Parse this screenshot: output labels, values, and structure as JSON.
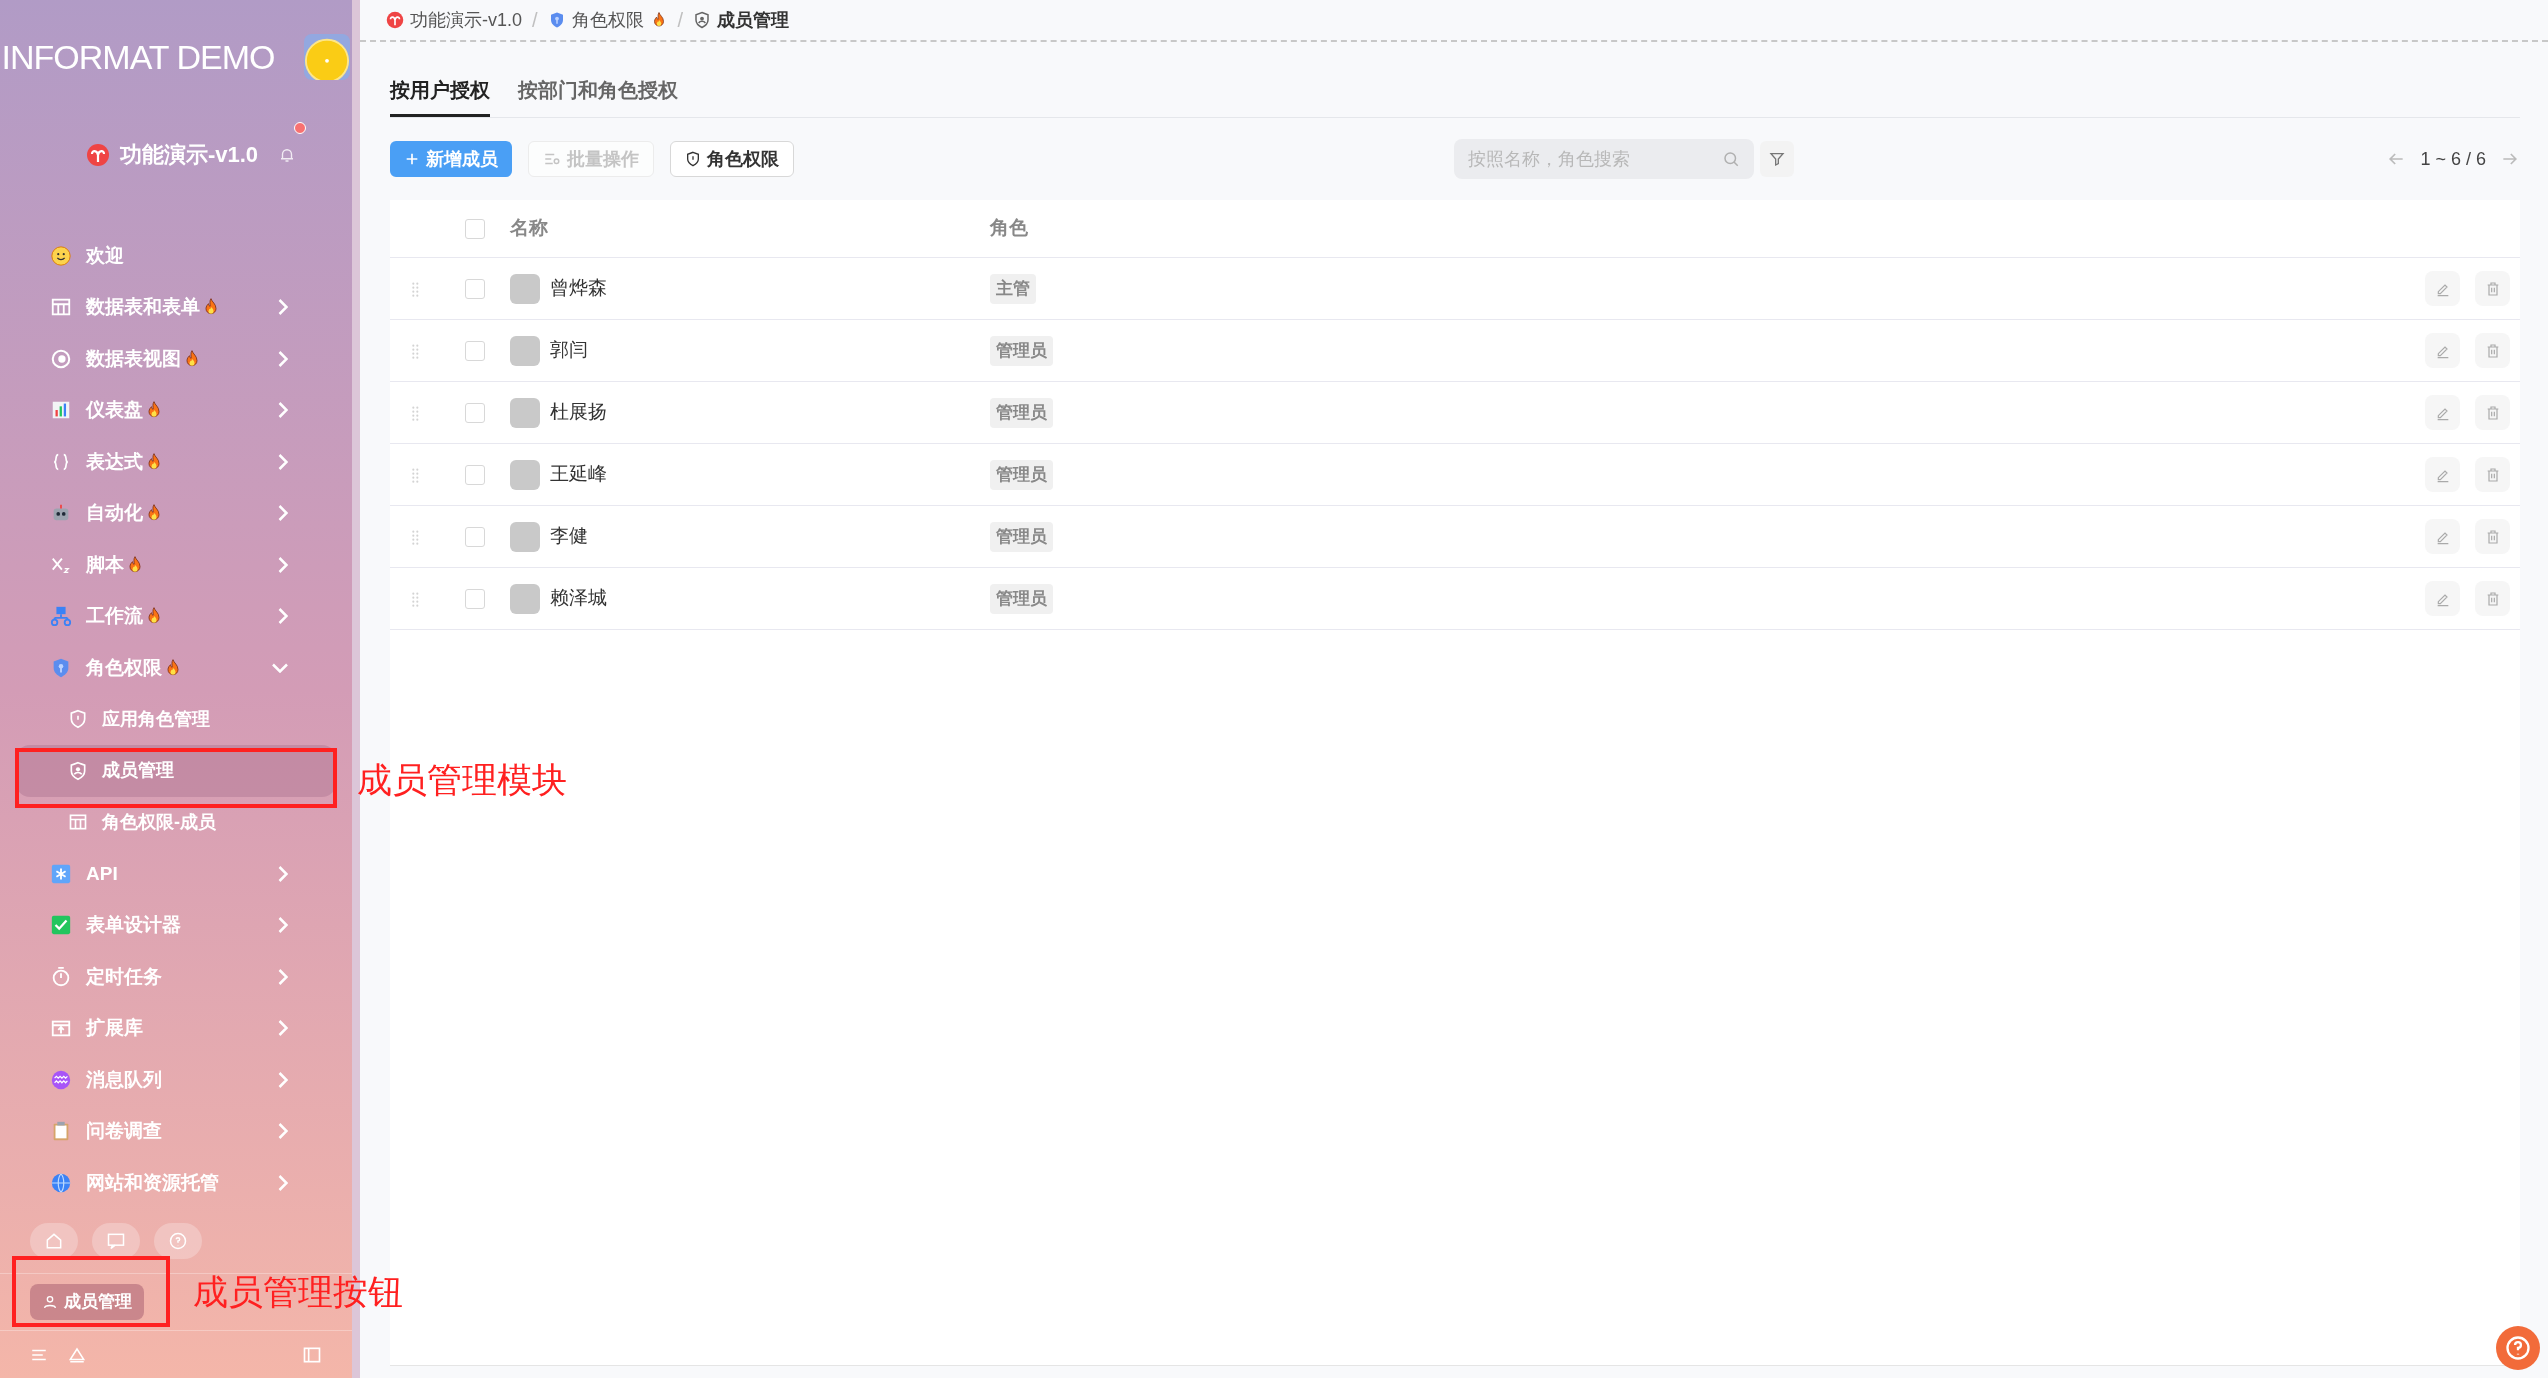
{
  "sidebar": {
    "logo_text": "INFORMAT DEMO",
    "project": "功能演示-v1.0",
    "nav": [
      {
        "label": "欢迎",
        "hot": false,
        "kind": "link",
        "selected": false
      },
      {
        "label": "数据表和表单",
        "hot": true,
        "kind": "group",
        "expanded": false,
        "selected": false
      },
      {
        "label": "数据表视图",
        "hot": true,
        "kind": "group",
        "expanded": false,
        "selected": false
      },
      {
        "label": "仪表盘",
        "hot": true,
        "kind": "group",
        "expanded": false,
        "selected": false
      },
      {
        "label": "表达式",
        "hot": true,
        "kind": "group",
        "expanded": false,
        "selected": false
      },
      {
        "label": "自动化",
        "hot": true,
        "kind": "group",
        "expanded": false,
        "selected": false
      },
      {
        "label": "脚本",
        "hot": true,
        "kind": "group",
        "expanded": false,
        "selected": false
      },
      {
        "label": "工作流",
        "hot": true,
        "kind": "group",
        "expanded": false,
        "selected": false
      },
      {
        "label": "角色权限",
        "hot": true,
        "kind": "group",
        "expanded": true,
        "selected": false,
        "children": [
          {
            "label": "应用角色管理",
            "selected": false
          },
          {
            "label": "成员管理",
            "selected": true
          },
          {
            "label": "角色权限-成员",
            "selected": false
          }
        ]
      },
      {
        "label": "API",
        "hot": false,
        "kind": "group",
        "expanded": false,
        "selected": false
      },
      {
        "label": "表单设计器",
        "hot": false,
        "kind": "group",
        "expanded": false,
        "selected": false
      },
      {
        "label": "定时任务",
        "hot": false,
        "kind": "group",
        "expanded": false,
        "selected": false
      },
      {
        "label": "扩展库",
        "hot": false,
        "kind": "group",
        "expanded": false,
        "selected": false
      },
      {
        "label": "消息队列",
        "hot": false,
        "kind": "group",
        "expanded": false,
        "selected": false
      },
      {
        "label": "问卷调查",
        "hot": false,
        "kind": "group",
        "expanded": false,
        "selected": false
      },
      {
        "label": "网站和资源托管",
        "hot": false,
        "kind": "group",
        "expanded": false,
        "selected": false
      }
    ],
    "member_button": "成员管理"
  },
  "breadcrumb": [
    {
      "label": "功能演示-v1.0",
      "hot": false,
      "current": false
    },
    {
      "separator": "/",
      "label": "角色权限",
      "hot": true,
      "current": false
    },
    {
      "separator": "/",
      "label": "成员管理",
      "hot": false,
      "current": true
    }
  ],
  "tabs": [
    {
      "label": "按用户授权",
      "selected": true
    },
    {
      "label": "按部门和角色授权",
      "selected": false
    }
  ],
  "toolbar": {
    "buttons": [
      {
        "label": "新增成员",
        "kind": "primary"
      },
      {
        "label": "批量操作",
        "kind": "disabled"
      },
      {
        "label": "角色权限",
        "kind": "outline"
      }
    ],
    "search": {
      "placeholder": "按照名称，角色搜索"
    },
    "pagination": "1 ~ 6 / 6"
  },
  "table": {
    "select_all_checked": false,
    "columns": [
      "名称",
      "角色"
    ],
    "rows": [
      {
        "name": "曾烨森",
        "role": "主管",
        "checked": false
      },
      {
        "name": "郭闫",
        "role": "管理员",
        "checked": false
      },
      {
        "name": "杜展扬",
        "role": "管理员",
        "checked": false
      },
      {
        "name": "王延峰",
        "role": "管理员",
        "checked": false
      },
      {
        "name": "李健",
        "role": "管理员",
        "checked": false
      },
      {
        "name": "赖泽城",
        "role": "管理员",
        "checked": false
      }
    ]
  },
  "annotations": [
    {
      "text": "成员管理模块"
    },
    {
      "text": "成员管理按钮"
    }
  ]
}
